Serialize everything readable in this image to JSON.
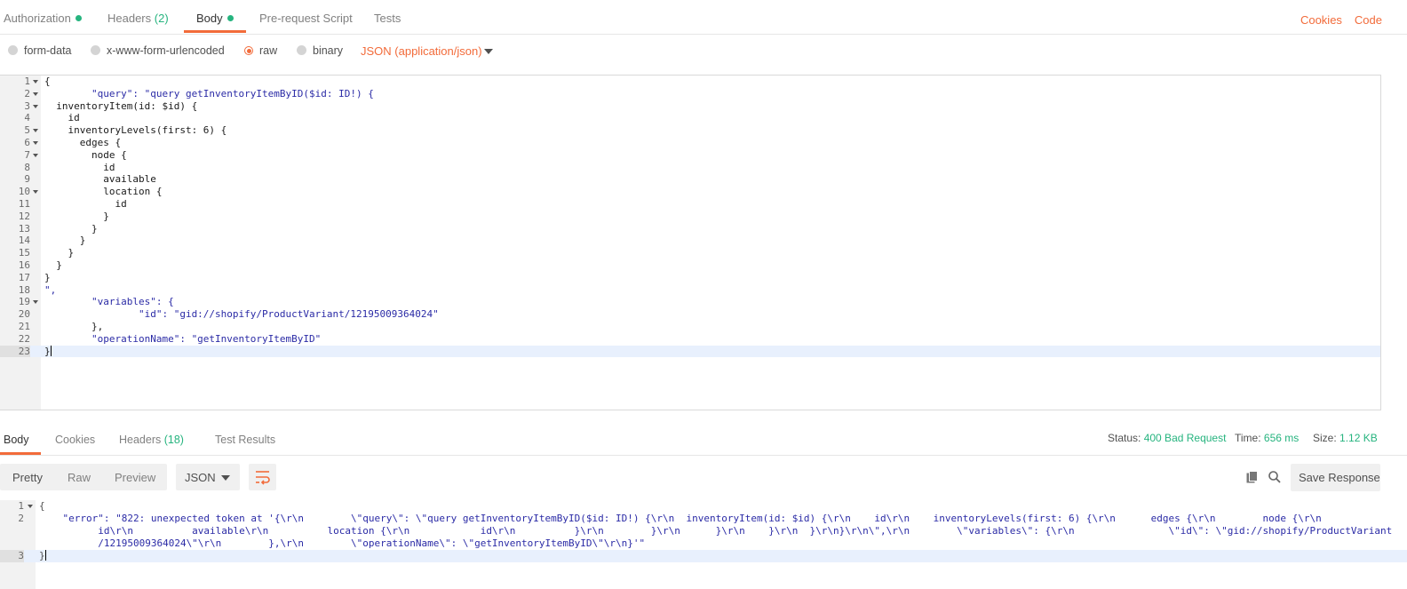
{
  "request_tabs": [
    {
      "label": "Authorization"
    },
    {
      "label": "Headers",
      "count": "(2)"
    },
    {
      "label": "Body"
    },
    {
      "label": "Pre-request Script"
    },
    {
      "label": "Tests"
    }
  ],
  "top_links": {
    "cookies": "Cookies",
    "code": "Code"
  },
  "body_modes": [
    "form-data",
    "x-www-form-urlencoded",
    "raw",
    "binary"
  ],
  "content_type": "JSON (application/json)",
  "request_lines": [
    "{",
    "\t\"query\": \"query getInventoryItemByID($id: ID!) {",
    "  inventoryItem(id: $id) {",
    "    id",
    "    inventoryLevels(first: 6) {",
    "      edges {",
    "        node {",
    "          id",
    "          available",
    "          location {",
    "            id",
    "          }",
    "        }",
    "      }",
    "    }",
    "  }",
    "}",
    "\",",
    "\t\"variables\": {",
    "\t\t\"id\": \"gid://shopify/ProductVariant/12195009364024\"",
    "\t},",
    "\t\"operationName\": \"getInventoryItemByID\"",
    "}"
  ],
  "response_tabs": [
    {
      "label": "Body"
    },
    {
      "label": "Cookies"
    },
    {
      "label": "Headers",
      "count": "(18)"
    },
    {
      "label": "Test Results"
    }
  ],
  "status": {
    "status_label": "Status:",
    "status_value": "400 Bad Request",
    "time_label": "Time:",
    "time_value": "656 ms",
    "size_label": "Size:",
    "size_value": "1.12 KB"
  },
  "view_modes": [
    "Pretty",
    "Raw",
    "Preview"
  ],
  "format": "JSON",
  "save_response": "Save Response",
  "response_lines": [
    "{",
    "    \"error\": \"822: unexpected token at '{\\r\\n        \\\"query\\\": \\\"query getInventoryItemByID($id: ID!) {\\r\\n  inventoryItem(id: $id) {\\r\\n    id\\r\\n    inventoryLevels(first: 6) {\\r\\n      edges {\\r\\n        node {\\r\\n",
    "          id\\r\\n          available\\r\\n          location {\\r\\n            id\\r\\n          }\\r\\n        }\\r\\n      }\\r\\n    }\\r\\n  }\\r\\n}\\r\\n\\\",\\r\\n        \\\"variables\\\": {\\r\\n                \\\"id\\\": \\\"gid://shopify/ProductVariant",
    "          /12195009364024\\\"\\r\\n        },\\r\\n        \\\"operationName\\\": \\\"getInventoryItemByID\\\"\\r\\n}'\"",
    "}"
  ],
  "colors": {
    "accent": "#f26b3a",
    "green": "#26b47f"
  }
}
